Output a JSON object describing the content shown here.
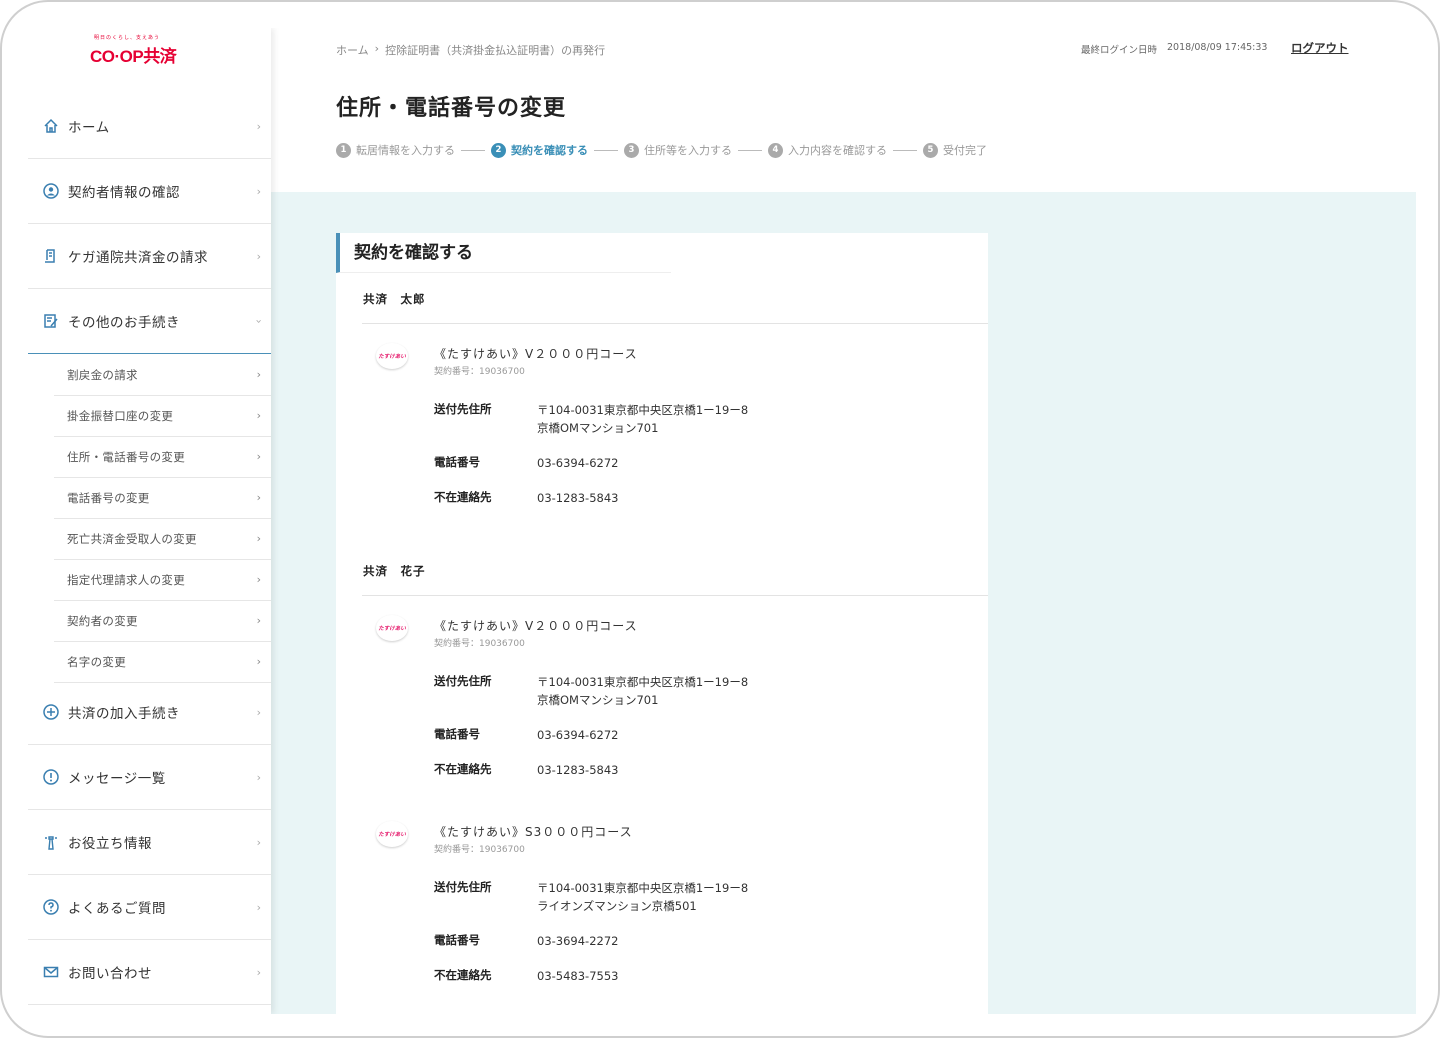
{
  "brand": {
    "tagline": "明日のくらし、支えあう",
    "name": "CO·OP共済"
  },
  "sidebar": {
    "items": [
      {
        "label": "ホーム"
      },
      {
        "label": "契約者情報の確認"
      },
      {
        "label": "ケガ通院共済金の請求"
      },
      {
        "label": "その他のお手続き"
      },
      {
        "label": "共済の加入手続き"
      },
      {
        "label": "メッセージ一覧"
      },
      {
        "label": "お役立ち情報"
      },
      {
        "label": "よくあるご質問"
      },
      {
        "label": "お問い合わせ"
      }
    ],
    "sub_items": [
      {
        "label": "割戻金の請求"
      },
      {
        "label": "掛金振替口座の変更"
      },
      {
        "label": "住所・電話番号の変更"
      },
      {
        "label": "電話番号の変更"
      },
      {
        "label": "死亡共済金受取人の変更"
      },
      {
        "label": "指定代理請求人の変更"
      },
      {
        "label": "契約者の変更"
      },
      {
        "label": "名字の変更"
      }
    ]
  },
  "header": {
    "breadcrumb": [
      "ホーム",
      "控除証明書（共済掛金払込証明書）の再発行"
    ],
    "breadcrumb_sep": "›",
    "last_login_label": "最終ログイン日時",
    "last_login_value": "2018/08/09 17:45:33",
    "logout": "ログアウト",
    "title": "住所・電話番号の変更",
    "steps": [
      {
        "num": "1",
        "label": "転居情報を入力する"
      },
      {
        "num": "2",
        "label": "契約を確認する"
      },
      {
        "num": "3",
        "label": "住所等を入力する"
      },
      {
        "num": "4",
        "label": "入力内容を確認する"
      },
      {
        "num": "5",
        "label": "受付完了"
      }
    ]
  },
  "card": {
    "title": "契約を確認する",
    "labels": {
      "address": "送付先住所",
      "phone": "電話番号",
      "absent": "不在連絡先"
    },
    "persons": [
      {
        "name": "共済　太郎",
        "contracts": [
          {
            "icon": "たすけあい",
            "name": "《たすけあい》V２０００円コース",
            "number": "契約番号：19036700",
            "address1": "〒104-0031東京都中央区京橋1ー19ー8",
            "address2": "京橋OMマンション701",
            "phone": "03-6394-6272",
            "absent": "03-1283-5843"
          }
        ]
      },
      {
        "name": "共済　花子",
        "contracts": [
          {
            "icon": "たすけあい",
            "name": "《たすけあい》V２０００円コース",
            "number": "契約番号：19036700",
            "address1": "〒104-0031東京都中央区京橋1ー19ー8",
            "address2": "京橋OMマンション701",
            "phone": "03-6394-6272",
            "absent": "03-1283-5843"
          },
          {
            "icon": "たすけあい",
            "name": "《たすけあい》S3０００円コース",
            "number": "契約番号：19036700",
            "address1": "〒104-0031東京都中央区京橋1ー19ー8",
            "address2": "ライオンズマンション京橋501",
            "phone": "03-3694-2272",
            "absent": "03-5483-7553"
          }
        ]
      }
    ]
  },
  "colors": {
    "accent": "#3a8fb7",
    "brand_red": "#e60033",
    "main_bg": "#e9f5f6"
  }
}
